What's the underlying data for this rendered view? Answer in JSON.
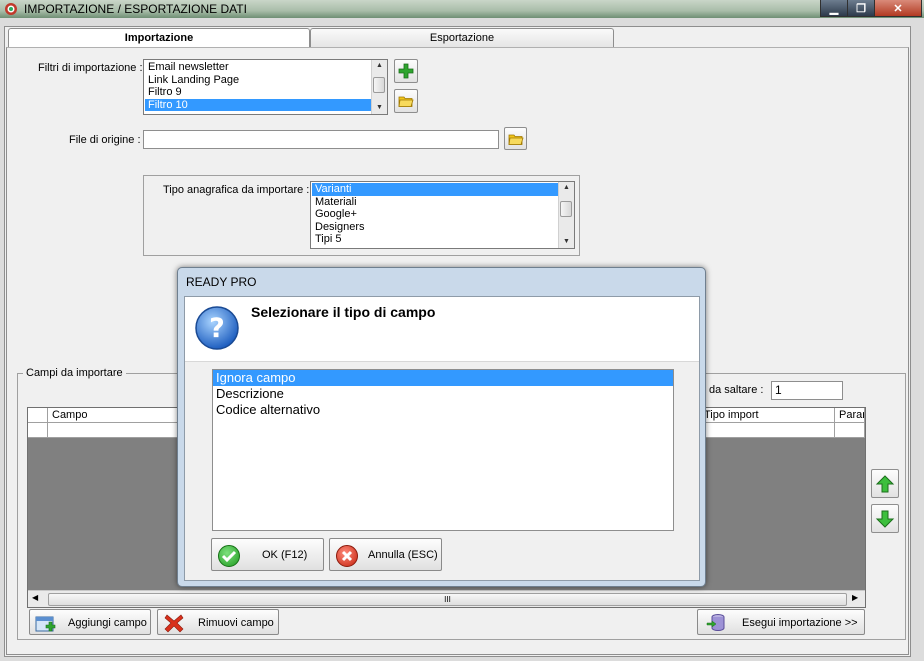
{
  "window": {
    "title": "IMPORTAZIONE / ESPORTAZIONE DATI",
    "controls": {
      "minimize": "▁",
      "maximize": "❐",
      "close": "✕"
    }
  },
  "tabs": [
    {
      "label": "Importazione",
      "active": true
    },
    {
      "label": "Esportazione",
      "active": false
    }
  ],
  "import": {
    "filters_label": "Filtri di importazione :",
    "filters": [
      {
        "label": "Email newsletter",
        "selected": false
      },
      {
        "label": "Link Landing Page",
        "selected": false
      },
      {
        "label": "Filtro 9",
        "selected": false
      },
      {
        "label": "Filtro 10",
        "selected": true
      }
    ],
    "source_file_label": "File di origine :",
    "source_file_value": "",
    "registry_type_label": "Tipo anagrafica da importare :",
    "registry_types": [
      {
        "label": "Varianti",
        "selected": true
      },
      {
        "label": "Materiali",
        "selected": false
      },
      {
        "label": "Google+",
        "selected": false
      },
      {
        "label": "Designers",
        "selected": false
      },
      {
        "label": "Tipi 5",
        "selected": false
      }
    ],
    "fields_group_label": "Campi da importare",
    "rows_to_skip_label": "da saltare :",
    "rows_to_skip_value": "1",
    "grid_columns": [
      "Campo",
      "Tipo import",
      "Parar"
    ],
    "hscroll_grip": "III",
    "add_field_button": "Aggiungi campo",
    "remove_field_button": "Rimuovi campo",
    "run_import_button": "Esegui importazione >>"
  },
  "dialog": {
    "title": "READY PRO",
    "question": "Selezionare il tipo di campo",
    "options": [
      {
        "label": "Ignora campo",
        "selected": true
      },
      {
        "label": "Descrizione",
        "selected": false
      },
      {
        "label": "Codice alternativo",
        "selected": false
      }
    ],
    "ok_button": "OK (F12)",
    "cancel_button": "Annulla (ESC)"
  },
  "colors": {
    "selection": "#3399ff",
    "accent_green": "#2fa52f",
    "cancel_red": "#d9301c",
    "question_blue": "#2f6fd0"
  }
}
